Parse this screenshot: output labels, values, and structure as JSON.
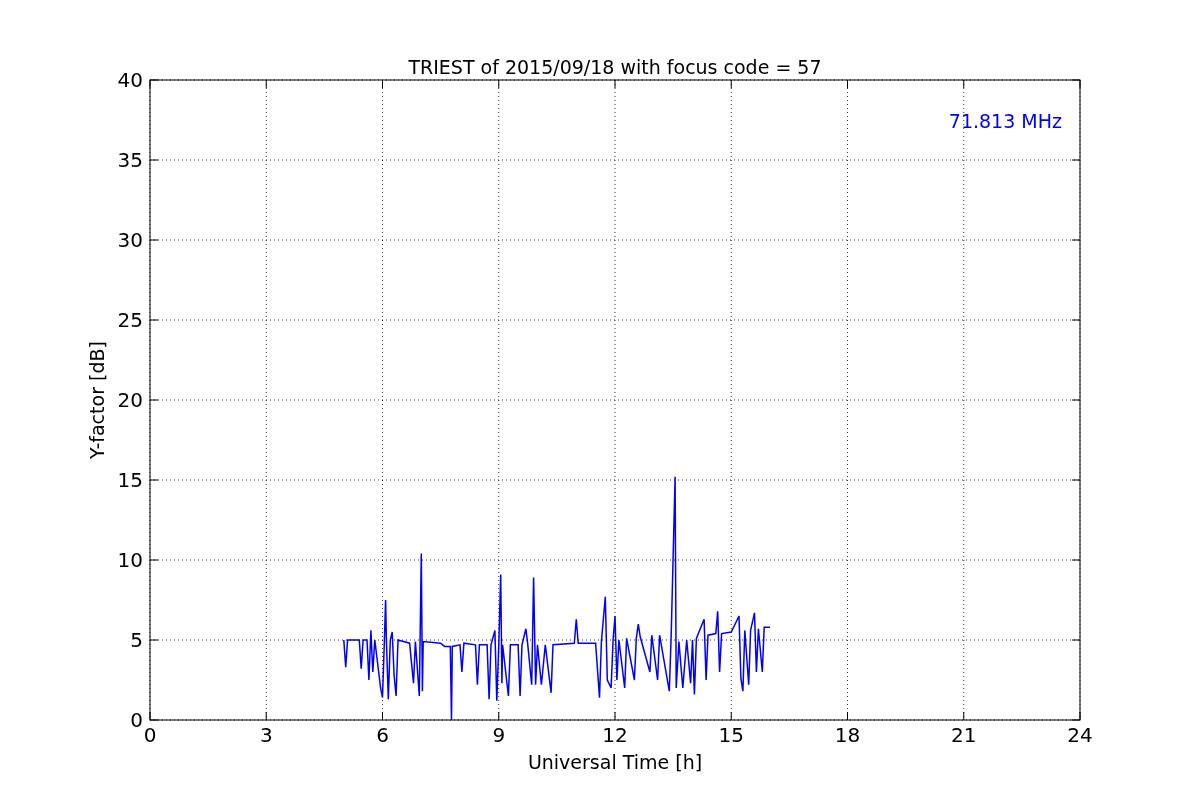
{
  "figure": {
    "chart_data": {
      "type": "line",
      "title": "TRIEST of 2015/09/18 with focus code = 57",
      "xlabel": "Universal Time [h]",
      "ylabel": "Y-factor [dB]",
      "xlim": [
        0,
        24
      ],
      "ylim": [
        0,
        40
      ],
      "xticks": [
        0,
        3,
        6,
        9,
        12,
        15,
        18,
        21,
        24
      ],
      "yticks": [
        0,
        5,
        10,
        15,
        20,
        25,
        30,
        35,
        40
      ],
      "x": [
        5.0,
        5.05,
        5.1,
        5.4,
        5.45,
        5.5,
        5.6,
        5.65,
        5.7,
        5.75,
        5.8,
        5.95,
        6.0,
        6.05,
        6.08,
        6.1,
        6.15,
        6.2,
        6.25,
        6.3,
        6.35,
        6.4,
        6.7,
        6.8,
        6.85,
        6.95,
        7.0,
        7.03,
        7.05,
        7.5,
        7.6,
        7.75,
        7.78,
        7.8,
        8.0,
        8.05,
        8.1,
        8.4,
        8.45,
        8.5,
        8.7,
        8.75,
        8.8,
        8.9,
        8.95,
        9.0,
        9.05,
        9.08,
        9.1,
        9.25,
        9.3,
        9.5,
        9.55,
        9.6,
        9.7,
        9.75,
        9.85,
        9.9,
        9.95,
        10.0,
        10.1,
        10.2,
        10.35,
        10.4,
        10.95,
        11.0,
        11.05,
        11.5,
        11.6,
        11.65,
        11.75,
        11.8,
        11.9,
        11.95,
        12.0,
        12.05,
        12.1,
        12.25,
        12.3,
        12.5,
        12.55,
        12.6,
        12.65,
        12.9,
        12.95,
        13.1,
        13.15,
        13.4,
        13.45,
        13.55,
        13.58,
        13.65,
        13.75,
        13.85,
        13.95,
        14.0,
        14.05,
        14.1,
        14.3,
        14.35,
        14.4,
        14.6,
        14.65,
        14.7,
        14.75,
        15.0,
        15.2,
        15.25,
        15.3,
        15.35,
        15.45,
        15.5,
        15.6,
        15.65,
        15.7,
        15.8,
        15.85,
        16.0
      ],
      "series": [
        {
          "name": "71.813 MHz",
          "color": "#0000ff",
          "values": [
            5.0,
            3.3,
            5.0,
            5.0,
            3.2,
            5.0,
            5.0,
            2.5,
            5.6,
            3.0,
            5.0,
            2.0,
            1.4,
            5.0,
            7.5,
            5.0,
            1.3,
            5.0,
            5.5,
            2.8,
            1.5,
            5.0,
            4.8,
            2.3,
            4.9,
            1.5,
            10.4,
            1.8,
            4.9,
            4.8,
            4.6,
            4.6,
            0.0,
            4.6,
            4.7,
            3.0,
            4.8,
            4.7,
            2.2,
            4.7,
            4.7,
            1.3,
            4.7,
            5.6,
            1.2,
            4.7,
            9.1,
            2.3,
            4.7,
            1.5,
            4.7,
            4.7,
            1.5,
            4.7,
            5.7,
            4.7,
            2.2,
            8.9,
            2.2,
            4.7,
            2.2,
            4.7,
            1.7,
            4.7,
            4.8,
            6.3,
            4.8,
            4.8,
            1.4,
            4.9,
            7.7,
            2.5,
            2.0,
            5.0,
            6.5,
            2.5,
            5.0,
            2.0,
            5.1,
            2.5,
            5.1,
            6.0,
            5.2,
            3.0,
            5.3,
            2.5,
            5.3,
            1.8,
            5.3,
            15.2,
            2.0,
            4.9,
            2.0,
            5.0,
            2.3,
            5.0,
            1.6,
            5.1,
            6.3,
            2.5,
            5.3,
            5.4,
            6.8,
            3.0,
            5.4,
            5.5,
            6.5,
            2.6,
            1.8,
            5.6,
            2.2,
            5.6,
            6.7,
            3.0,
            5.7,
            3.0,
            5.8,
            5.8
          ]
        }
      ],
      "grid": true
    }
  }
}
